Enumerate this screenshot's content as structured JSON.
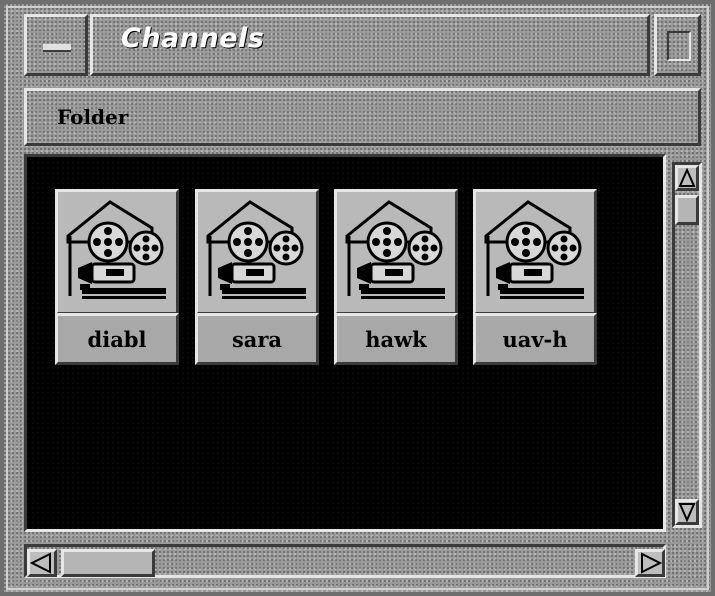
{
  "window": {
    "title": "Channels"
  },
  "menubar": {
    "items": [
      {
        "label": "Folder"
      }
    ]
  },
  "channels": [
    {
      "label": "diabl",
      "icon": "movie-projector-icon"
    },
    {
      "label": "sara",
      "icon": "movie-projector-icon"
    },
    {
      "label": "hawk",
      "icon": "movie-projector-icon"
    },
    {
      "label": "uav-h",
      "icon": "movie-projector-icon"
    }
  ],
  "colors": {
    "chrome": "#9a9a9a",
    "icon_area_background": "#000000",
    "title_text": "#ffffff"
  }
}
